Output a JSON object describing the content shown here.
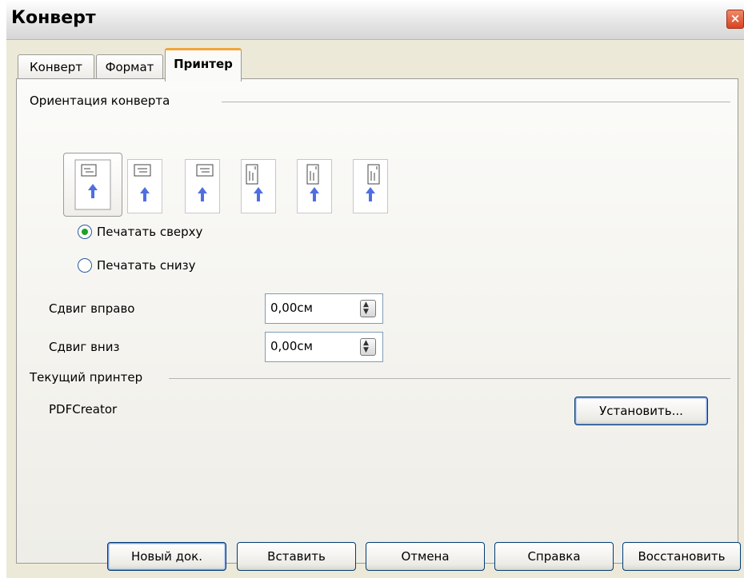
{
  "window": {
    "title": "Конверт",
    "close_glyph": "×"
  },
  "tabs": [
    {
      "label": "Конверт",
      "active": false
    },
    {
      "label": "Формат",
      "active": false
    },
    {
      "label": "Принтер",
      "active": true
    }
  ],
  "orientation": {
    "section_title": "Ориентация конверта",
    "options_count_visible": 6,
    "radio_top": "Печатать сверху",
    "radio_bottom": "Печатать снизу",
    "selected_radio": "top"
  },
  "shift": {
    "right_label": "Сдвиг вправо",
    "right_value": "0,00см",
    "down_label": "Сдвиг вниз",
    "down_value": "0,00см"
  },
  "printer": {
    "section_title": "Текущий принтер",
    "name": "PDFCreator",
    "setup_button": "Установить..."
  },
  "footer": {
    "new_doc": "Новый док.",
    "insert": "Вставить",
    "cancel": "Отмена",
    "help": "Справка",
    "restore": "Восстановить"
  },
  "colors": {
    "accent_tab": "#f0a53a",
    "close_button": "#d8431f",
    "arrow_blue": "#4f6fe0",
    "radio_dot": "#21a121"
  }
}
